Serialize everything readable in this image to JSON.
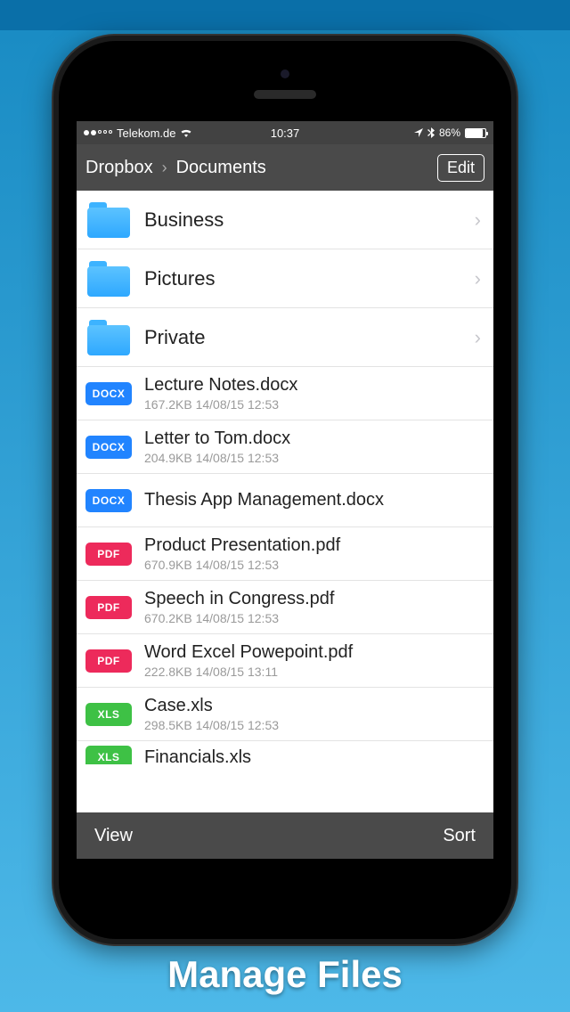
{
  "status_bar": {
    "carrier": "Telekom.de",
    "time": "10:37",
    "battery_pct": "86%"
  },
  "nav": {
    "crumb_parent": "Dropbox",
    "crumb_current": "Documents",
    "edit_label": "Edit"
  },
  "folders": [
    {
      "name": "Business"
    },
    {
      "name": "Pictures"
    },
    {
      "name": "Private"
    }
  ],
  "files": [
    {
      "name": "Lecture Notes.docx",
      "size": "167.2KB",
      "date": "14/08/15 12:53",
      "badge": "DOCX",
      "badge_class": "badge-docx"
    },
    {
      "name": "Letter to Tom.docx",
      "size": "204.9KB",
      "date": "14/08/15 12:53",
      "badge": "DOCX",
      "badge_class": "badge-docx"
    },
    {
      "name": "Thesis App Management.docx",
      "size": "",
      "date": "",
      "badge": "DOCX",
      "badge_class": "badge-docx"
    },
    {
      "name": "Product Presentation.pdf",
      "size": "670.9KB",
      "date": "14/08/15 12:53",
      "badge": "PDF",
      "badge_class": "badge-pdf"
    },
    {
      "name": "Speech in Congress.pdf",
      "size": "670.2KB",
      "date": "14/08/15 12:53",
      "badge": "PDF",
      "badge_class": "badge-pdf"
    },
    {
      "name": "Word Excel Powepoint.pdf",
      "size": "222.8KB",
      "date": "14/08/15 13:11",
      "badge": "PDF",
      "badge_class": "badge-pdf"
    },
    {
      "name": "Case.xls",
      "size": "298.5KB",
      "date": "14/08/15 12:53",
      "badge": "XLS",
      "badge_class": "badge-xls"
    }
  ],
  "partial_file": {
    "name": "Financials.xls",
    "badge": "XLS",
    "badge_class": "badge-xls"
  },
  "bottom_bar": {
    "view_label": "View",
    "sort_label": "Sort"
  },
  "caption": "Manage Files"
}
